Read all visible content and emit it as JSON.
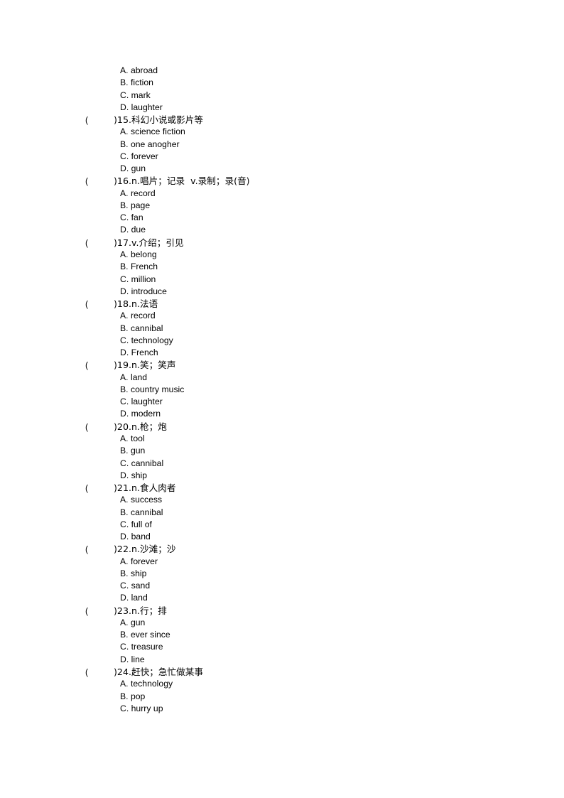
{
  "document": {
    "page_background": "#ffffff",
    "text_color": "#000000",
    "type": "vocabulary-multiple-choice-worksheet"
  },
  "leading_options": [
    {
      "label": "A. abroad"
    },
    {
      "label": "B. fiction"
    },
    {
      "label": "C. mark"
    },
    {
      "label": "D. laughter"
    }
  ],
  "questions": [
    {
      "paren_open": "(",
      "stem": ")15.科幻小说或影片等",
      "number": "15",
      "prompt": "科幻小说或影片等",
      "options": [
        {
          "label": "A. science fiction"
        },
        {
          "label": "B. one anogher"
        },
        {
          "label": "C. forever"
        },
        {
          "label": "D. gun"
        }
      ]
    },
    {
      "paren_open": "(",
      "stem": ")16.n.唱片；记录  v.录制；录(音)",
      "number": "16",
      "prompt": "n.唱片；记录  v.录制；录(音)",
      "options": [
        {
          "label": "A. record"
        },
        {
          "label": "B. page"
        },
        {
          "label": "C. fan"
        },
        {
          "label": "D. due"
        }
      ]
    },
    {
      "paren_open": "(",
      "stem": ")17.v.介绍；引见",
      "number": "17",
      "prompt": "v.介绍；引见",
      "options": [
        {
          "label": "A. belong"
        },
        {
          "label": "B. French"
        },
        {
          "label": "C. million"
        },
        {
          "label": "D. introduce"
        }
      ]
    },
    {
      "paren_open": "(",
      "stem": ")18.n.法语",
      "number": "18",
      "prompt": "n.法语",
      "options": [
        {
          "label": "A. record"
        },
        {
          "label": "B. cannibal"
        },
        {
          "label": "C. technology"
        },
        {
          "label": "D. French"
        }
      ]
    },
    {
      "paren_open": "(",
      "stem": ")19.n.笑；笑声",
      "number": "19",
      "prompt": "n.笑；笑声",
      "options": [
        {
          "label": "A. land"
        },
        {
          "label": "B. country music"
        },
        {
          "label": "C. laughter"
        },
        {
          "label": "D. modern"
        }
      ]
    },
    {
      "paren_open": "(",
      "stem": ")20.n.枪；炮",
      "number": "20",
      "prompt": "n.枪；炮",
      "options": [
        {
          "label": "A. tool"
        },
        {
          "label": "B. gun"
        },
        {
          "label": "C. cannibal"
        },
        {
          "label": "D. ship"
        }
      ]
    },
    {
      "paren_open": "(",
      "stem": ")21.n.食人肉者",
      "number": "21",
      "prompt": "n.食人肉者",
      "options": [
        {
          "label": "A. success"
        },
        {
          "label": "B. cannibal"
        },
        {
          "label": "C. full of"
        },
        {
          "label": "D. band"
        }
      ]
    },
    {
      "paren_open": "(",
      "stem": ")22.n.沙滩；沙",
      "number": "22",
      "prompt": "n.沙滩；沙",
      "options": [
        {
          "label": "A. forever"
        },
        {
          "label": "B. ship"
        },
        {
          "label": "C. sand"
        },
        {
          "label": "D. land"
        }
      ]
    },
    {
      "paren_open": "(",
      "stem": ")23.n.行；排",
      "number": "23",
      "prompt": "n.行；排",
      "options": [
        {
          "label": "A. gun"
        },
        {
          "label": "B. ever since"
        },
        {
          "label": "C. treasure"
        },
        {
          "label": "D. line"
        }
      ]
    },
    {
      "paren_open": "(",
      "stem": ")24.赶快；急忙做某事",
      "number": "24",
      "prompt": "赶快；急忙做某事",
      "options": [
        {
          "label": "A. technology"
        },
        {
          "label": "B. pop"
        },
        {
          "label": "C. hurry up"
        }
      ]
    }
  ]
}
